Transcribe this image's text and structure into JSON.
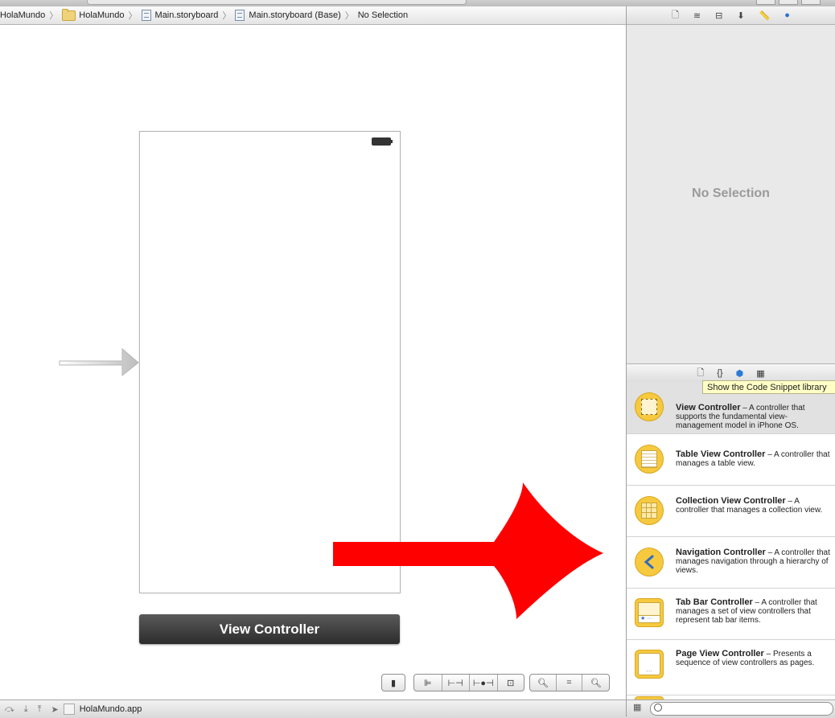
{
  "breadcrumb": {
    "items": [
      "HolaMundo",
      "HolaMundo",
      "Main.storyboard",
      "Main.storyboard (Base)",
      "No Selection"
    ]
  },
  "canvas": {
    "scene_label": "View Controller"
  },
  "bottom_bar": {
    "scheme_name": "HolaMundo.app"
  },
  "inspector": {
    "empty_text": "No Selection"
  },
  "library": {
    "tooltip": "Show the Code Snippet library",
    "items": [
      {
        "title": "View Controller",
        "desc": " – A controller that supports the fundamental view-management model in iPhone OS.",
        "icon": "view-controller-icon"
      },
      {
        "title": "Table View Controller",
        "desc": " – A controller that manages a table view.",
        "icon": "table-view-controller-icon"
      },
      {
        "title": "Collection View Controller",
        "desc": " – A controller that manages a collection view.",
        "icon": "collection-view-controller-icon"
      },
      {
        "title": "Navigation Controller",
        "desc": " – A controller that manages navigation through a hierarchy of views.",
        "icon": "navigation-controller-icon"
      },
      {
        "title": "Tab Bar Controller",
        "desc": " – A controller that manages a set of view controllers that represent tab bar items.",
        "icon": "tab-bar-controller-icon"
      },
      {
        "title": "Page View Controller",
        "desc": " – Presents a sequence of view controllers as pages.",
        "icon": "page-view-controller-icon"
      }
    ]
  },
  "colors": {
    "library_icon": "#f7c93e",
    "annotation_arrow": "#ff0000",
    "scene_bar": "#3a3a3a"
  }
}
